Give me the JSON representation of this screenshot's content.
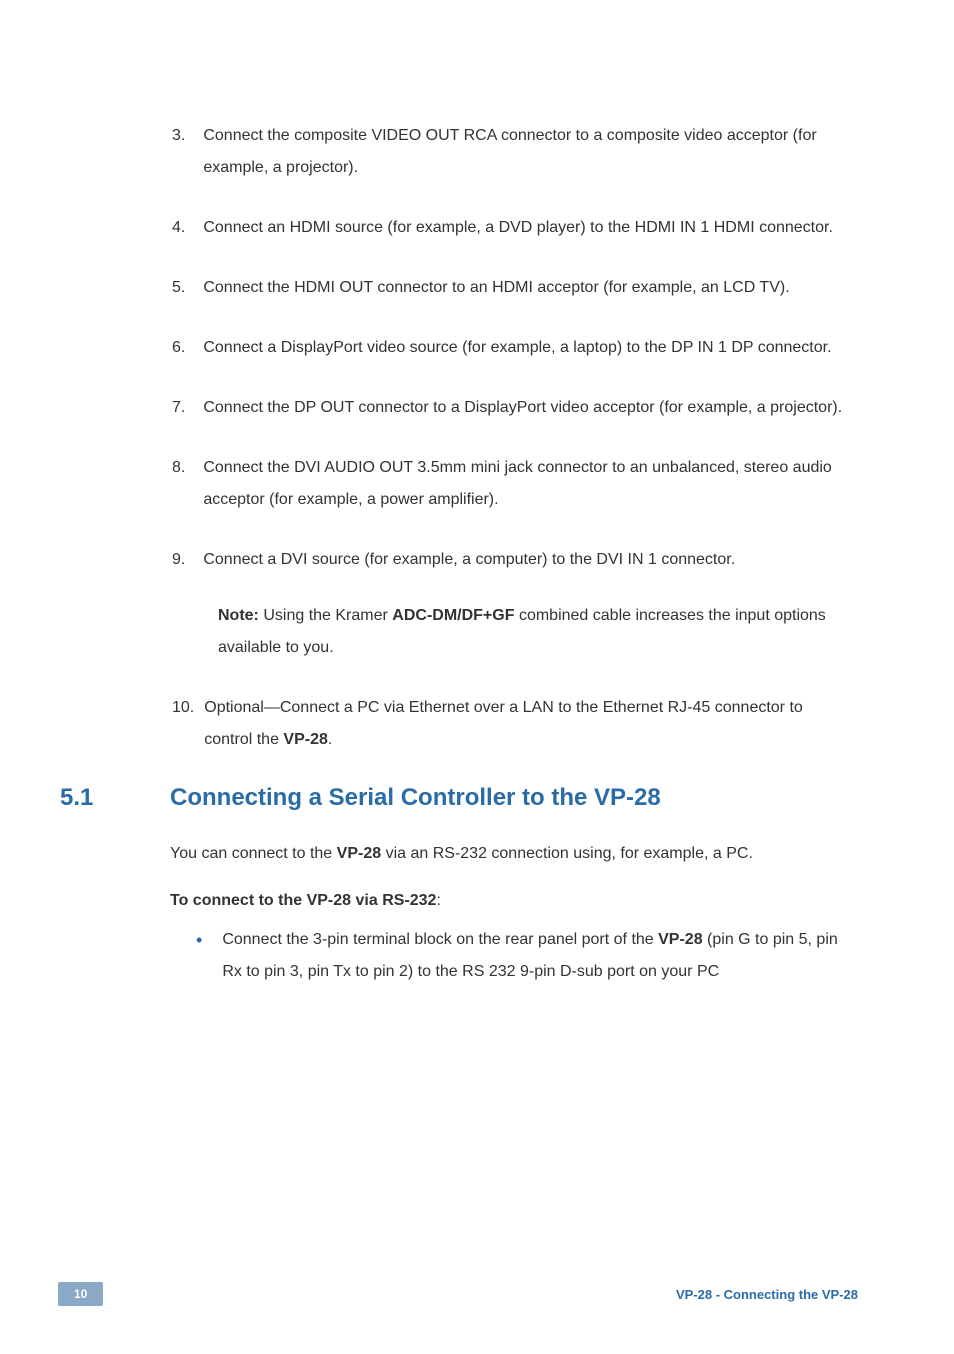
{
  "list": {
    "i3": {
      "num": "3.",
      "text": "Connect the composite VIDEO OUT RCA connector to a composite video acceptor (for example, a projector)."
    },
    "i4": {
      "num": "4.",
      "text": "Connect an HDMI source (for example, a DVD player) to the HDMI IN 1 HDMI connector."
    },
    "i5": {
      "num": "5.",
      "text": "Connect the HDMI OUT connector to an HDMI acceptor (for example, an LCD TV)."
    },
    "i6": {
      "num": "6.",
      "text": "Connect a DisplayPort video source (for example, a laptop) to the DP IN 1 DP connector."
    },
    "i7": {
      "num": "7.",
      "text": "Connect the DP OUT connector to a DisplayPort video acceptor (for example, a projector)."
    },
    "i8": {
      "num": "8.",
      "text": "Connect the DVI AUDIO OUT 3.5mm mini jack connector to an unbalanced, stereo audio acceptor (for example, a power amplifier)."
    },
    "i9": {
      "num": "9.",
      "text": "Connect a DVI source (for example, a computer) to the DVI IN 1 connector."
    },
    "note": {
      "label": "Note:",
      "before": " Using the Kramer ",
      "bold": "ADC-DM/DF+GF",
      "after": " combined cable increases the input options available to you."
    },
    "i10": {
      "num": "10.",
      "before": "Optional—Connect a PC via Ethernet over a LAN to the Ethernet RJ-45 connector to control the ",
      "bold": "VP-28",
      "after": "."
    }
  },
  "section": {
    "num": "5.1",
    "title": "Connecting a Serial Controller to the VP-28",
    "para": {
      "before": "You can connect to the ",
      "bold": "VP-28",
      "after": " via an RS-232 connection using, for example, a PC."
    },
    "subhead": {
      "text": "To connect to the VP-28 via RS-232",
      "suffix": ":"
    },
    "bullet": {
      "before": "Connect the 3-pin terminal block on the rear panel port of the ",
      "bold": "VP-28",
      "after": " (pin G to pin 5, pin Rx to pin 3, pin Tx to pin 2) to the RS 232 9-pin D-sub port on your PC"
    }
  },
  "footer": {
    "pagenum": "10",
    "text": "VP-28 - Connecting the VP-28"
  }
}
